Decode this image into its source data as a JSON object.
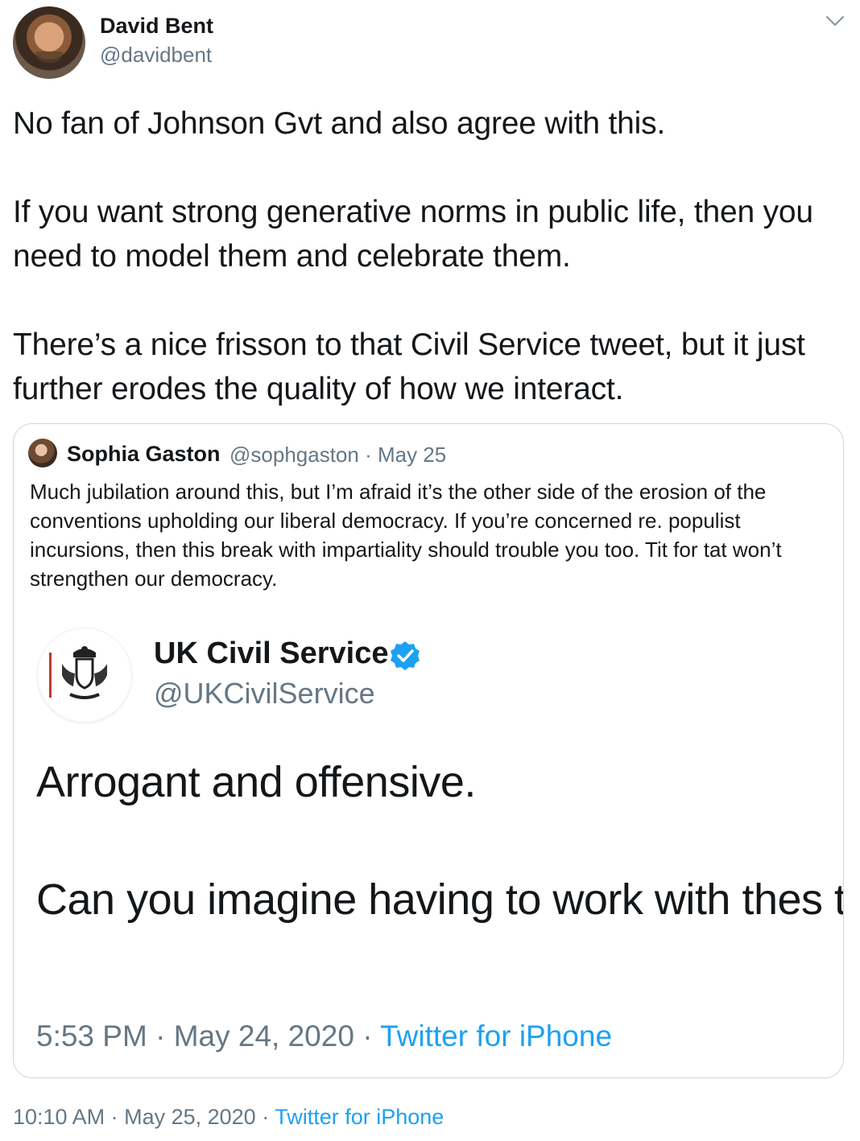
{
  "tweet": {
    "author": {
      "name": "David Bent",
      "handle": "@davidbent",
      "avatar_icon": "user-avatar"
    },
    "paragraphs": [
      "No fan of Johnson Gvt and also agree with this.",
      "If you want strong generative norms in public life, then you need to model them and celebrate them.",
      "There’s a nice frisson to that Civil Service tweet, but it just further erodes the quality of how we interact."
    ],
    "time": "10:10 AM",
    "date": "May 25, 2020",
    "source": "Twitter for iPhone"
  },
  "quoted": {
    "author": {
      "name": "Sophia Gaston",
      "handle": "@sophgaston",
      "date": "May 25"
    },
    "text": "Much jubilation around this, but I’m afraid it’s the other side of the erosion of the conventions upholding our liberal democracy. If you’re concerned re. populist incursions, then this break with impartiality should trouble you too. Tit for tat won’t strengthen our democracy.",
    "embedded": {
      "name": "UK Civil Service",
      "handle": "@UKCivilService",
      "lines": [
        "Arrogant and offensive.",
        "Can you imagine having to work with thes twisters?"
      ],
      "time": "5:53 PM",
      "date": "May 24, 2020",
      "source": "Twitter for iPhone"
    }
  },
  "colors": {
    "text": "#14171a",
    "secondary": "#657786",
    "link": "#1da1f2",
    "border": "#ccd6dd"
  }
}
